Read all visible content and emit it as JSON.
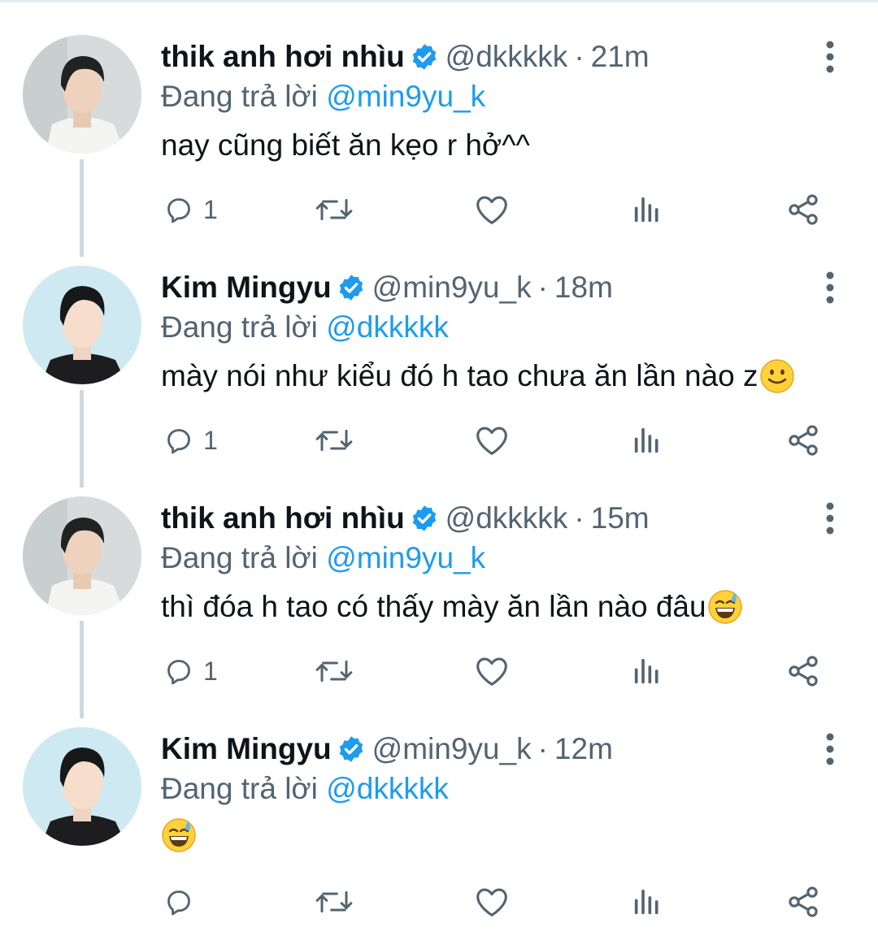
{
  "colors": {
    "accent": "#1d9bf0",
    "text": "#0f1419",
    "secondary": "#536471",
    "thread_line": "#cfd9de"
  },
  "tweets": [
    {
      "name": "thik anh hơi nhìu",
      "verified": true,
      "handle": "@dkkkkk",
      "separator": "·",
      "time": "21m",
      "reply_prefix": "Đang trả lời",
      "reply_handle": "@min9yu_k",
      "text": "nay cũng biết ăn kẹo r hở^^",
      "emoji": "",
      "reply_count": "1"
    },
    {
      "name": "Kim Mingyu",
      "verified": true,
      "handle": "@min9yu_k",
      "separator": "·",
      "time": "18m",
      "reply_prefix": "Đang trả lời",
      "reply_handle": "@dkkkkk",
      "text": "mày nói như kiểu đó h tao chưa ăn lần nào z",
      "emoji": "slightly-smiling-face",
      "reply_count": "1"
    },
    {
      "name": "thik anh hơi nhìu",
      "verified": true,
      "handle": "@dkkkkk",
      "separator": "·",
      "time": "15m",
      "reply_prefix": "Đang trả lời",
      "reply_handle": "@min9yu_k",
      "text": "thì đóa h tao có thấy mày ăn lần nào đâu",
      "emoji": "grinning-face-with-sweat",
      "reply_count": "1"
    },
    {
      "name": "Kim Mingyu",
      "verified": true,
      "handle": "@min9yu_k",
      "separator": "·",
      "time": "12m",
      "reply_prefix": "Đang trả lời",
      "reply_handle": "@dkkkkk",
      "text": "",
      "emoji": "grinning-face-with-sweat",
      "reply_count": ""
    }
  ],
  "icons": {
    "reply": "reply-icon",
    "retweet": "retweet-icon",
    "like": "heart-icon",
    "analytics": "analytics-icon",
    "share": "share-icon",
    "more": "more-vertical-icon",
    "verified": "verified-badge-icon"
  }
}
